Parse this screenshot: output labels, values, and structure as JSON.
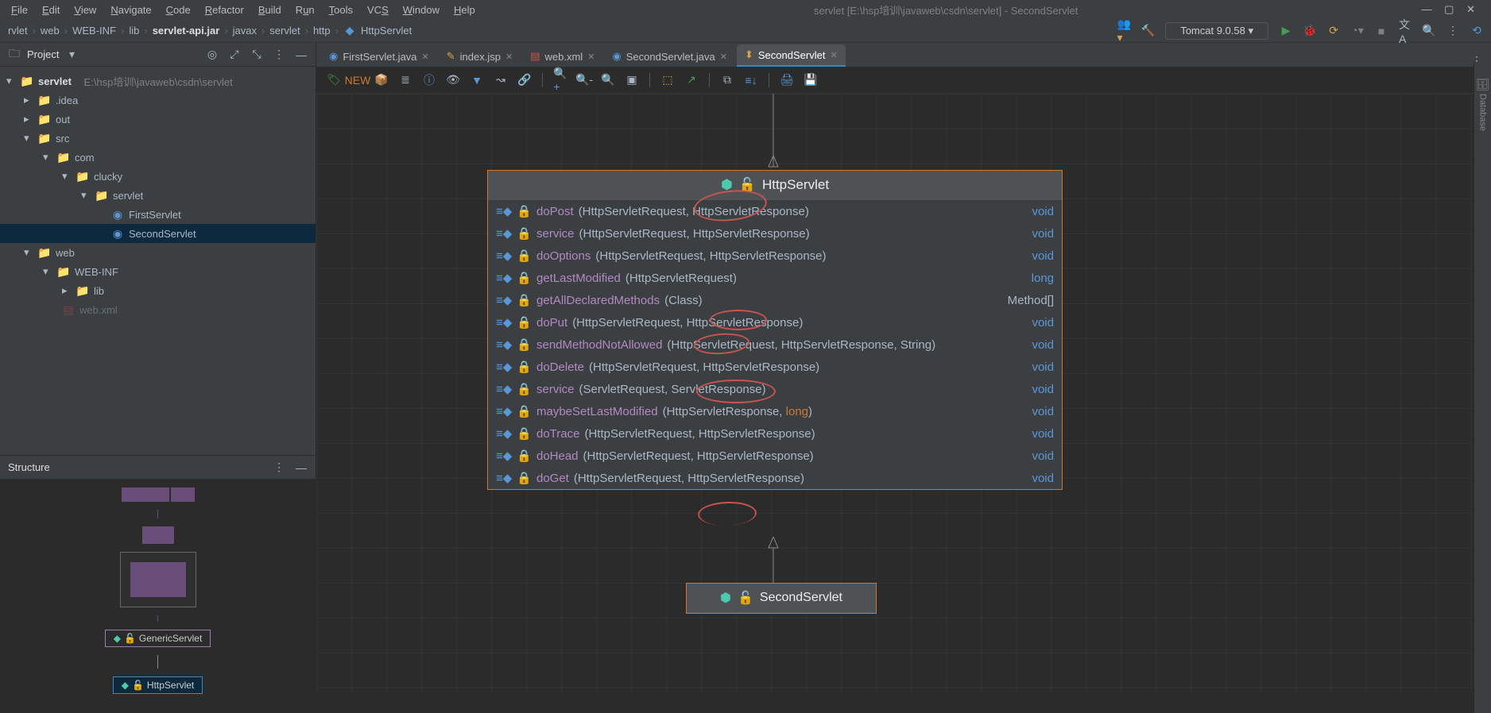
{
  "window": {
    "title": "servlet [E:\\hsp培训\\javaweb\\csdn\\servlet] - SecondServlet"
  },
  "menu": [
    "File",
    "Edit",
    "View",
    "Navigate",
    "Code",
    "Refactor",
    "Build",
    "Run",
    "Tools",
    "VCS",
    "Window",
    "Help"
  ],
  "breadcrumbs": [
    "rvlet",
    "web",
    "WEB-INF",
    "lib",
    "servlet-api.jar",
    "javax",
    "servlet",
    "http",
    "HttpServlet"
  ],
  "run_config": "Tomcat 9.0.58",
  "project_tool": {
    "title": "Project"
  },
  "tree": {
    "root": {
      "name": "servlet",
      "path": "E:\\hsp培训\\javaweb\\csdn\\servlet"
    },
    "idea": ".idea",
    "out": "out",
    "src": "src",
    "com": "com",
    "clucky": "clucky",
    "servlet_pkg": "servlet",
    "first": "FirstServlet",
    "second": "SecondServlet",
    "web": "web",
    "webinf": "WEB-INF",
    "lib": "lib",
    "webxml": "web.xml"
  },
  "structure_tool": {
    "title": "Structure"
  },
  "mini_labels": {
    "generic": "GenericServlet",
    "http": "HttpServlet"
  },
  "tabs": [
    {
      "label": "FirstServlet.java",
      "icon": "class"
    },
    {
      "label": "index.jsp",
      "icon": "jsp"
    },
    {
      "label": "web.xml",
      "icon": "xml"
    },
    {
      "label": "SecondServlet.java",
      "icon": "class"
    },
    {
      "label": "SecondServlet",
      "icon": "diagram",
      "active": true
    }
  ],
  "uml": {
    "title": "HttpServlet",
    "rows": [
      {
        "lock": "y",
        "name": "doPost",
        "params": "(HttpServletRequest, HttpServletResponse)",
        "ret": "void",
        "mark": true
      },
      {
        "lock": "y",
        "name": "service",
        "params": "(HttpServletRequest, HttpServletResponse)",
        "ret": "void"
      },
      {
        "lock": "y",
        "name": "doOptions",
        "params": "(HttpServletRequest, HttpServletResponse)",
        "ret": "void"
      },
      {
        "lock": "y",
        "name": "getLastModified",
        "params": "(HttpServletRequest)",
        "ret": "long"
      },
      {
        "lock": "r",
        "name": "getAllDeclaredMethods",
        "params": "(Class<?>)",
        "ret": "Method[]",
        "mark": true
      },
      {
        "lock": "y",
        "name": "doPut",
        "params": "(HttpServletRequest, HttpServletResponse)",
        "ret": "void",
        "mark": true
      },
      {
        "lock": "r",
        "name": "sendMethodNotAllowed",
        "params": "(HttpServletRequest, HttpServletResponse, String)",
        "ret": "void"
      },
      {
        "lock": "y",
        "name": "doDelete",
        "params": "(HttpServletRequest, HttpServletResponse)",
        "ret": "void",
        "mark": true
      },
      {
        "lock": "g",
        "name": "service",
        "params": "(ServletRequest, ServletResponse)",
        "ret": "void"
      },
      {
        "lock": "r",
        "name": "maybeSetLastModified",
        "params": "(HttpServletResponse, long)",
        "ret": "void"
      },
      {
        "lock": "y",
        "name": "doTrace",
        "params": "(HttpServletRequest, HttpServletResponse)",
        "ret": "void"
      },
      {
        "lock": "y",
        "name": "doHead",
        "params": "(HttpServletRequest, HttpServletResponse)",
        "ret": "void"
      },
      {
        "lock": "y",
        "name": "doGet",
        "params": "(HttpServletRequest, HttpServletResponse)",
        "ret": "void",
        "mark": true
      }
    ]
  },
  "second_box": {
    "title": "SecondServlet"
  },
  "right_rail": {
    "label": "Database"
  }
}
